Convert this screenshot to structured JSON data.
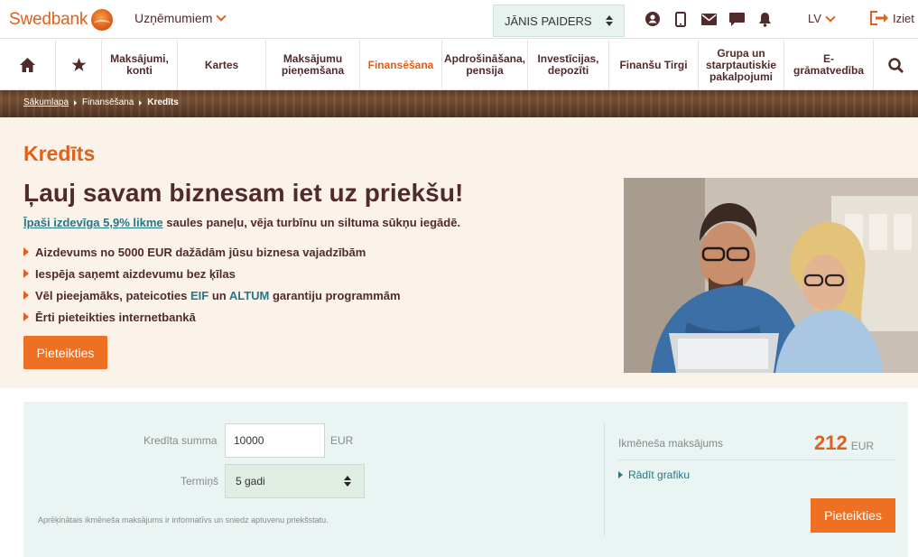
{
  "header": {
    "brand": "Swedbank",
    "segment_label": "Uzņēmumiem",
    "user_name": "JĀNIS PAIDERS",
    "icons": [
      "user-icon",
      "mobile-icon",
      "mail-icon",
      "chat-icon",
      "bell-icon"
    ],
    "language": "LV",
    "logout_label": "Iziet"
  },
  "nav": {
    "home_icon": "home-icon",
    "favorites_icon": "star-icon",
    "items": [
      "Maksājumi, konti",
      "Kartes",
      "Maksājumu pieņemšana",
      "Finansēšana",
      "Apdrošināšana, pensija",
      "Investīcijas, depozīti",
      "Finanšu Tirgi",
      "Grupa un starptautiskie pakalpojumi",
      "E-grāmatvedība"
    ],
    "active_index": 3,
    "search_icon": "search-icon"
  },
  "breadcrumb": [
    "Sākumlapa",
    "Finansēšana",
    "Kredīts"
  ],
  "hero": {
    "title": "Kredīts",
    "headline": "Ļauj savam biznesam iet uz priekšu!",
    "promo_link": "Īpaši izdevīga 5,9% likme",
    "promo_rest": " saules paneļu, vēja turbīnu un siltuma sūkņu iegādē.",
    "bullets": [
      "Aizdevums no 5000 EUR dažādām jūsu biznesa vajadzībām",
      "Iespēja saņemt aizdevumu bez ķīlas"
    ],
    "bullet3_a": "Vēl pieejamāks, pateicoties ",
    "bullet3_eif": "EIF",
    "bullet3_b": " un ",
    "bullet3_altum": "ALTUM",
    "bullet3_c": " garantiju programmām",
    "bullet4": "Ērti pieteikties internetbankā",
    "apply_label": "Pieteikties"
  },
  "calculator": {
    "amount_label": "Kredīta summa",
    "amount_value": "10000",
    "currency": "EUR",
    "term_label": "Termiņš",
    "term_value": "5 gadi",
    "note": "Aprēķinātais ikmēneša maksājums ir informatīvs un sniedz aptuvenu priekšstatu.",
    "monthly_label": "Ikmēneša maksājums",
    "monthly_value": "212",
    "monthly_currency": "EUR",
    "schedule_label": "Rādīt grafiku",
    "apply_label": "Pieteikties"
  },
  "colors": {
    "brand_orange": "#e0611b",
    "button_orange": "#ee7023",
    "text_brown": "#512b2b",
    "link_teal": "#257886",
    "hero_bg": "#fbf2e9",
    "calc_bg": "#e9f4f3"
  }
}
